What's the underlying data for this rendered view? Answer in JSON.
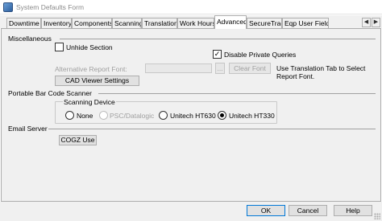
{
  "window": {
    "title": "System Defaults Form"
  },
  "tabs": [
    {
      "label": "Downtime"
    },
    {
      "label": "Inventory"
    },
    {
      "label": "Components"
    },
    {
      "label": "Scanning"
    },
    {
      "label": "Translation"
    },
    {
      "label": "Work Hours"
    },
    {
      "label": "Advanced"
    },
    {
      "label": "SecureTrac"
    },
    {
      "label": "Eqp User Fields"
    }
  ],
  "active_tab": "Advanced",
  "tab_nav": {
    "left": "◀",
    "right": "▶"
  },
  "miscellaneous": {
    "heading": "Miscellaneous",
    "unhide_section": {
      "label": "Unhide Section",
      "checked": false
    },
    "disable_private_queries": {
      "label": "Disable Private Queries",
      "checked": true,
      "mark": "✓"
    },
    "alt_report_font_label": "Alternative Report Font:",
    "alt_report_font_value": "",
    "browse_label": "...",
    "clear_font_label": "Clear Font",
    "translation_hint": "Use Translation Tab to Select Report Font.",
    "cad_viewer_label": "CAD Viewer Settings"
  },
  "barcode": {
    "heading": "Portable Bar Code Scanner",
    "group_label": "Scanning Device",
    "options": [
      {
        "label": "None",
        "selected": false,
        "enabled": true
      },
      {
        "label": "PSC/Datalogic",
        "selected": false,
        "enabled": false
      },
      {
        "label": "Unitech HT630",
        "selected": false,
        "enabled": true
      },
      {
        "label": "Unitech HT330",
        "selected": true,
        "enabled": true
      }
    ]
  },
  "email": {
    "heading": "Email Server",
    "cogz_use_label": "COGZ Use"
  },
  "footer": {
    "ok": "OK",
    "cancel": "Cancel",
    "help": "Help"
  }
}
